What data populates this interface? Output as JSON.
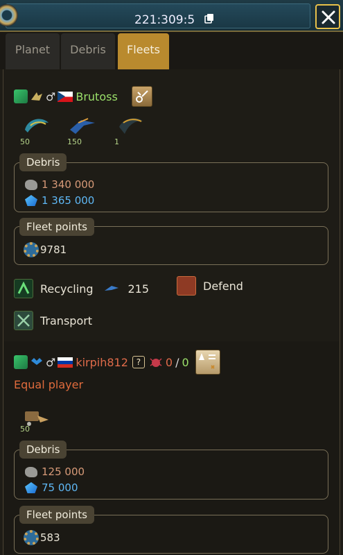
{
  "header": {
    "coordinates": "221:309:5"
  },
  "tabs": [
    {
      "label": "Planet",
      "active": false
    },
    {
      "label": "Debris",
      "active": false
    },
    {
      "label": "Fleets",
      "active": true
    }
  ],
  "fleet1": {
    "player_name": "Brutoss",
    "ships": [
      {
        "count": "50"
      },
      {
        "count": "150"
      },
      {
        "count": "1"
      }
    ],
    "debris": {
      "title": "Debris",
      "metal": "1 340 000",
      "crystal": "1 365 000"
    },
    "fleet_points": {
      "title": "Fleet points",
      "value": "9781"
    },
    "actions": {
      "recycling_label": "Recycling",
      "recycler_count": "215",
      "defend_label": "Defend",
      "transport_label": "Transport"
    }
  },
  "fleet2": {
    "player_name": "kirpih812",
    "question_mark": "?",
    "ratio_left": "0",
    "ratio_sep": "/",
    "ratio_right": "0",
    "status": "Equal player",
    "ships": [
      {
        "count": "50"
      }
    ],
    "debris": {
      "title": "Debris",
      "metal": "125 000",
      "crystal": "75 000"
    },
    "fleet_points": {
      "title": "Fleet points",
      "value": "583"
    }
  },
  "colors": {
    "accent": "#b98a2e",
    "player_green": "#9be06a",
    "player_red": "#e06b4a",
    "metal": "#d79a78",
    "crystal": "#5fb8f5"
  }
}
